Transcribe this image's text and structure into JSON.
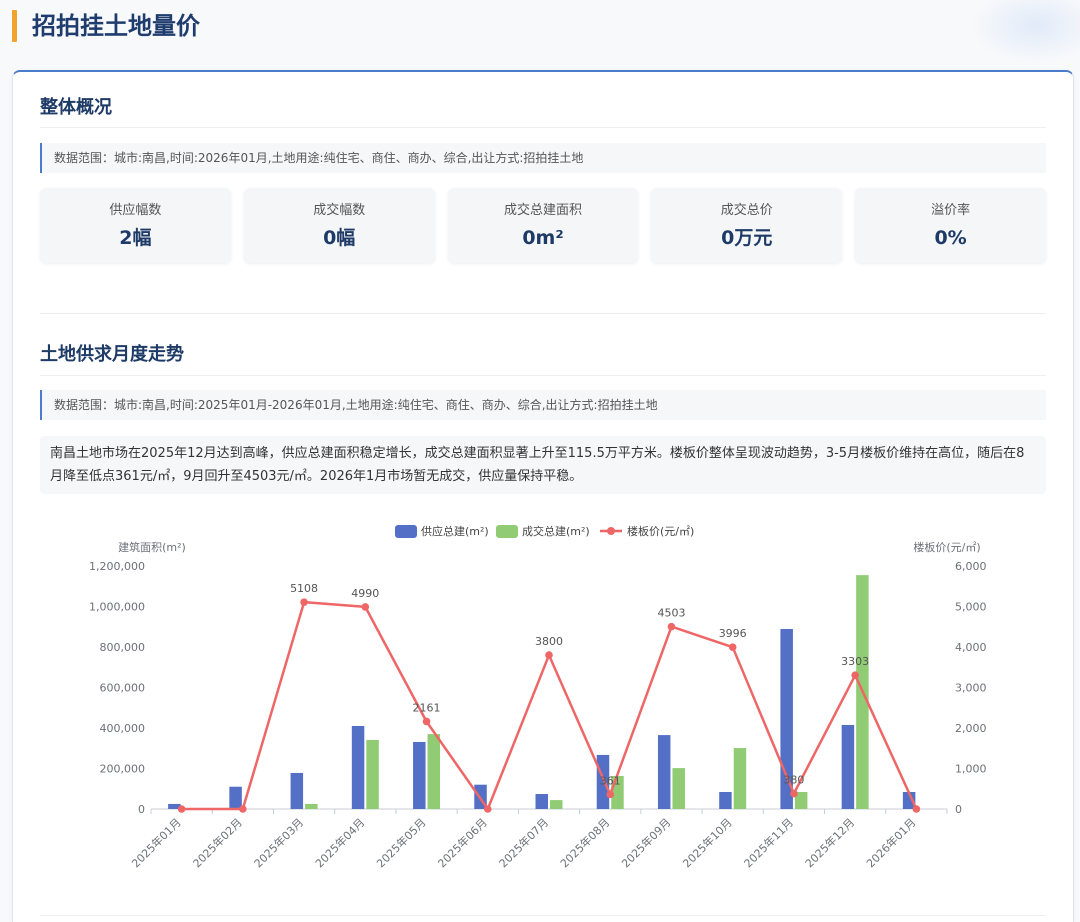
{
  "page": {
    "title": "招拍挂土地量价"
  },
  "overview": {
    "heading": "整体概况",
    "note": "数据范围：城市:南昌,时间:2026年01月,土地用途:纯住宅、商住、商办、综合,出让方式:招拍挂土地",
    "stats": [
      {
        "label": "供应幅数",
        "value": "2幅"
      },
      {
        "label": "成交幅数",
        "value": "0幅"
      },
      {
        "label": "成交总建面积",
        "value": "0m²"
      },
      {
        "label": "成交总价",
        "value": "0万元"
      },
      {
        "label": "溢价率",
        "value": "0%"
      }
    ]
  },
  "trend": {
    "heading": "土地供求月度走势",
    "note": "数据范围：城市:南昌,时间:2025年01月-2026年01月,土地用途:纯住宅、商住、商办、综合,出让方式:招拍挂土地",
    "summary": "南昌土地市场在2025年12月达到高峰，供应总建面积稳定增长，成交总建面积显著上升至115.5万平方米。楼板价整体呈现波动趋势，3-5月楼板价维持在高位，随后在8月降至低点361元/㎡，9月回升至4503元/㎡。2026年1月市场暂无成交，供应量保持平稳。"
  },
  "colors": {
    "title_accent": "#f0a32f",
    "heading_text": "#1e3a66",
    "card_top_border": "#4a7cc9"
  },
  "chart_data": {
    "type": "bar",
    "categories": [
      "2025年01月",
      "2025年02月",
      "2025年03月",
      "2025年04月",
      "2025年05月",
      "2025年06月",
      "2025年07月",
      "2025年08月",
      "2025年09月",
      "2025年10月",
      "2025年11月",
      "2025年12月",
      "2026年01月"
    ],
    "series": [
      {
        "name": "供应总建(m²)",
        "type": "bar",
        "y_axis": "left",
        "color": "#5470c6",
        "values": [
          25000,
          110000,
          178000,
          410000,
          331000,
          120000,
          74000,
          267000,
          365000,
          84000,
          889000,
          415000,
          84000
        ]
      },
      {
        "name": "成交总建(m²)",
        "type": "bar",
        "y_axis": "left",
        "color": "#91cc75",
        "values": [
          0,
          0,
          25000,
          341000,
          370000,
          0,
          44000,
          163000,
          202000,
          301000,
          84000,
          1155000,
          0
        ]
      },
      {
        "name": "楼板价(元/㎡)",
        "type": "line",
        "y_axis": "right",
        "color": "#ee6666",
        "values": [
          0,
          0,
          5108,
          4990,
          2161,
          0,
          3800,
          361,
          4503,
          3996,
          380,
          3303,
          0
        ]
      }
    ],
    "ylabel": "建筑面积(m²)",
    "ylabel_right": "楼板价(元/㎡)",
    "ylim": [
      0,
      1200000
    ],
    "ylim_right": [
      0,
      6000
    ],
    "yticks_left": [
      "0",
      "200,000",
      "400,000",
      "600,000",
      "800,000",
      "1,000,000",
      "1,200,000"
    ],
    "yticks_right": [
      "0",
      "1,000",
      "2,000",
      "3,000",
      "4,000",
      "5,000",
      "6,000"
    ],
    "legend": "top-center",
    "grid": false
  }
}
